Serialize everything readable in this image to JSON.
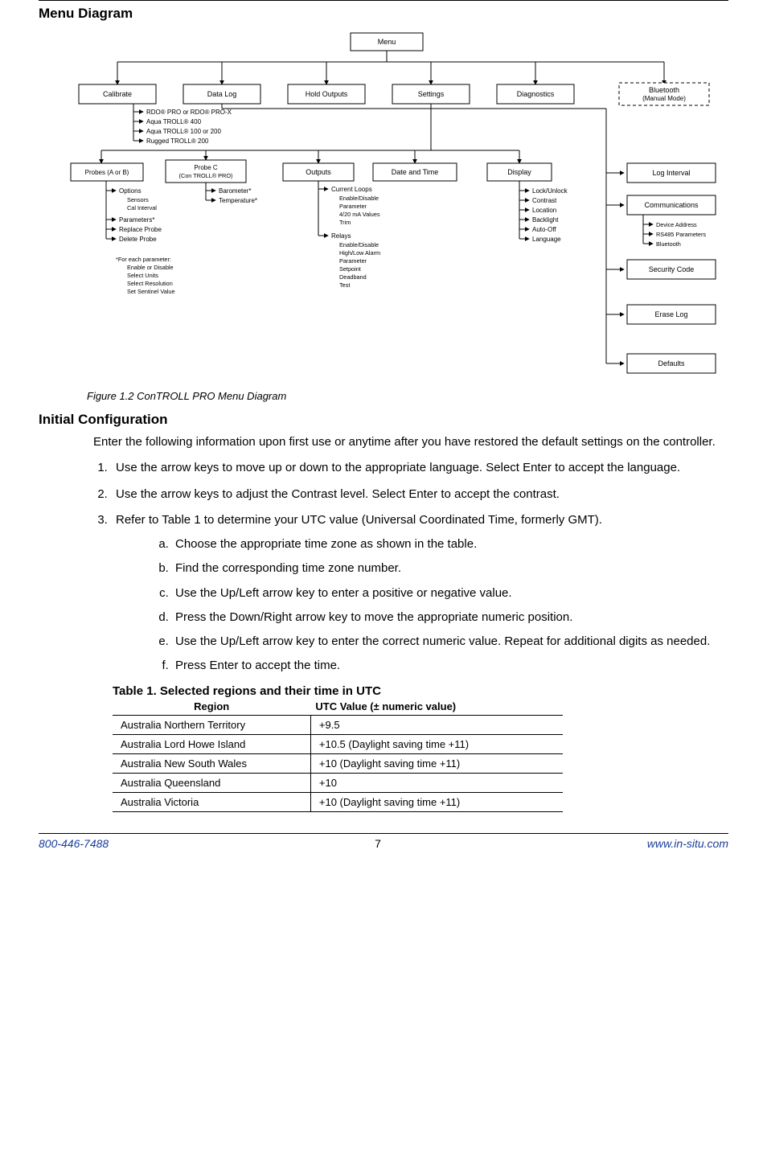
{
  "headings": {
    "menu_diagram": "Menu Diagram",
    "initial_config": "Initial Configuration"
  },
  "diagram": {
    "top": "Menu",
    "row": {
      "calibrate": "Calibrate",
      "datalog": "Data Log",
      "hold": "Hold Outputs",
      "settings": "Settings",
      "diagnostics": "Diagnostics",
      "bluetooth_l1": "Bluetooth",
      "bluetooth_l2": "(Manual Mode)"
    },
    "cal_list": [
      "RDO® PRO or RDO® PRO-X",
      "Aqua TROLL® 400",
      "Aqua TROLL® 100 or 200",
      "Rugged TROLL® 200"
    ],
    "sub": {
      "probes": "Probes (A or B)",
      "probec_l1": "Probe C",
      "probec_l2": "(Con TROLL® PRO)",
      "outputs": "Outputs",
      "datetime": "Date and Time",
      "display": "Display"
    },
    "probes_sub": [
      "Options",
      "Sensors",
      "Cal Interval",
      "Parameters*",
      "Replace Probe",
      "Delete Probe"
    ],
    "probes_note": [
      "*For each parameter:",
      "Enable or Disable",
      "Select Units",
      "Select Resolution",
      "Set Sentinel Value"
    ],
    "probec_sub": [
      "Barometer*",
      "Temperature*"
    ],
    "outputs_sub_head": "Current Loops",
    "outputs_sub": [
      "Enable/Disable",
      "Parameter",
      "4/20 mA Values",
      "Trim"
    ],
    "outputs_relays": "Relays",
    "outputs_relays_sub": [
      "Enable/Disable",
      "High/Low Alarm",
      "Parameter",
      "Setpoint",
      "Deadband",
      "Test"
    ],
    "display_sub": [
      "Lock/Unlock",
      "Contrast",
      "Location",
      "Backlight",
      "Auto-Off",
      "Language"
    ],
    "right_boxes": [
      "Log Interval",
      "Communications",
      "Security Code",
      "Erase Log",
      "Defaults"
    ],
    "comm_sub": [
      "Device Address",
      "RS485 Parameters",
      "Bluetooth"
    ]
  },
  "figure_caption": "Figure 1.2 ConTROLL PRO Menu Diagram",
  "intro": "Enter the following information upon first use or anytime after you have restored the default settings on the controller.",
  "steps": {
    "1": "Use the arrow keys to move up or down to the appropriate language. Select Enter to accept the language.",
    "2": "Use the arrow keys to adjust the Contrast level. Select Enter to accept the contrast.",
    "3": "Refer to Table 1 to determine your UTC value (Universal Coordinated Time, formerly GMT).",
    "3a": "Choose the appropriate time zone as shown in the table.",
    "3b": "Find the corresponding time zone number.",
    "3c": "Use the Up/Left arrow key to enter a positive or negative value.",
    "3d": "Press the Down/Right arrow key to move the appropriate numeric position.",
    "3e": "Use the Up/Left arrow key to enter the correct numeric value. Repeat for additional digits as needed.",
    "3f": "Press Enter to accept the time."
  },
  "table": {
    "title": "Table 1. Selected regions and their time in UTC",
    "h1": "Region",
    "h2": "UTC Value (± numeric value)",
    "rows": [
      {
        "r": "Australia Northern Territory",
        "v": "+9.5"
      },
      {
        "r": "Australia Lord Howe Island",
        "v": "+10.5 (Daylight saving time +11)"
      },
      {
        "r": "Australia New South Wales",
        "v": "+10 (Daylight saving time +11)"
      },
      {
        "r": "Australia Queensland",
        "v": "+10"
      },
      {
        "r": "Australia Victoria",
        "v": "+10 (Daylight saving time +11)"
      }
    ]
  },
  "footer": {
    "phone": "800-446-7488",
    "page": "7",
    "url": "www.in-situ.com"
  }
}
